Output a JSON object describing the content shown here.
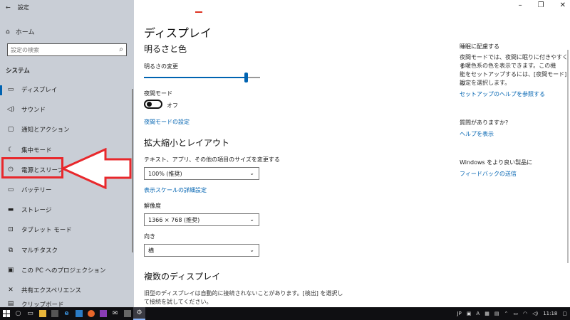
{
  "window": {
    "app_title": "設定"
  },
  "sidebar": {
    "home_label": "ホーム",
    "search_placeholder": "設定の検索",
    "section": "システム",
    "items": [
      {
        "label": "ディスプレイ",
        "icon": "monitor-icon"
      },
      {
        "label": "サウンド",
        "icon": "speaker-icon"
      },
      {
        "label": "通知とアクション",
        "icon": "notification-icon"
      },
      {
        "label": "集中モード",
        "icon": "moon-icon"
      },
      {
        "label": "電源とスリープ",
        "icon": "power-icon"
      },
      {
        "label": "バッテリー",
        "icon": "battery-icon"
      },
      {
        "label": "ストレージ",
        "icon": "storage-icon"
      },
      {
        "label": "タブレット モード",
        "icon": "tablet-icon"
      },
      {
        "label": "マルチタスク",
        "icon": "multitask-icon"
      },
      {
        "label": "この PC へのプロジェクション",
        "icon": "projection-icon"
      },
      {
        "label": "共有エクスペリエンス",
        "icon": "share-icon"
      }
    ],
    "partial_item": "クリップボード"
  },
  "main": {
    "title": "ディスプレイ",
    "brightness_heading": "明るさと色",
    "brightness_label": "明るさの変更",
    "brightness_level": 0.88,
    "night_label": "夜間モード",
    "night_state": "オフ",
    "night_link": "夜間モードの設定",
    "scale_heading": "拡大縮小とレイアウト",
    "scale_label": "テキスト、アプリ、その他の項目のサイズを変更する",
    "scale_value": "100% (推奨)",
    "scale_link": "表示スケールの詳細設定",
    "resolution_label": "解像度",
    "resolution_value": "1366 × 768 (推奨)",
    "orientation_label": "向き",
    "orientation_value": "横",
    "multi_heading": "複数のディスプレイ",
    "multi_text_1": "旧型のディスプレイは自動的に接続されないことがあります。[検出] を選択し",
    "multi_text_2": "て接続を試してください。"
  },
  "right_panel": {
    "sleep_heading": "睡眠に配慮する",
    "sleep_text": [
      "夜間モードでは、夜間に眠りに付きやすくす",
      "る暖色系の色を表示できます。この機",
      "能をセットアップするには、[夜間モード] の",
      "設定を選択します。"
    ],
    "sleep_link": "セットアップのヘルプを参照する",
    "question_heading": "質問がありますか?",
    "question_link": "ヘルプを表示",
    "feedback_heading": "Windows をより良い製品に",
    "feedback_link": "フィードバックの送信"
  },
  "taskbar": {
    "lang": "JP",
    "time": "11:18"
  },
  "colors": {
    "accent": "#0063b1",
    "highlight": "#e8282c"
  }
}
